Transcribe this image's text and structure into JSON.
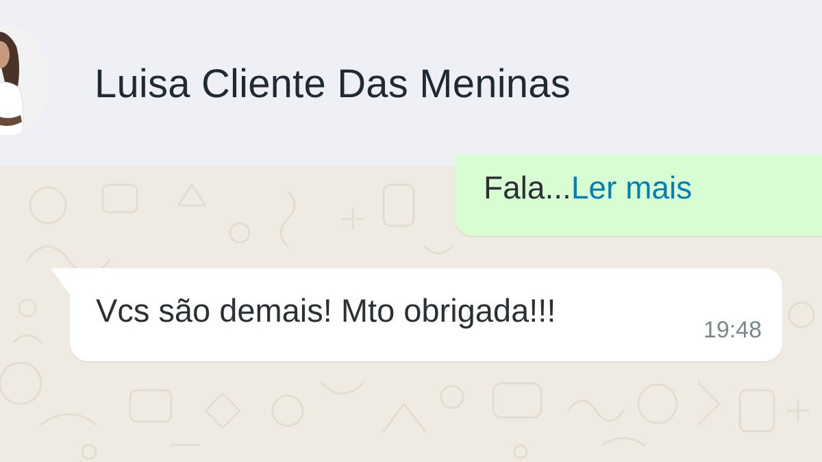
{
  "header": {
    "contact_name": "Luisa Cliente Das Meninas",
    "avatar_icon": "contact-photo"
  },
  "messages": {
    "outgoing": {
      "text": "Fala...",
      "read_more_label": "Ler mais"
    },
    "incoming": {
      "text": "Vcs são demais! Mto obrigada!!!",
      "time": "19:48"
    }
  },
  "colors": {
    "header_bg": "#eef0f5",
    "wallpaper_bg": "#efeae2",
    "outgoing_bubble": "#d9fdd3",
    "incoming_bubble": "#ffffff",
    "link": "#027eb5"
  }
}
